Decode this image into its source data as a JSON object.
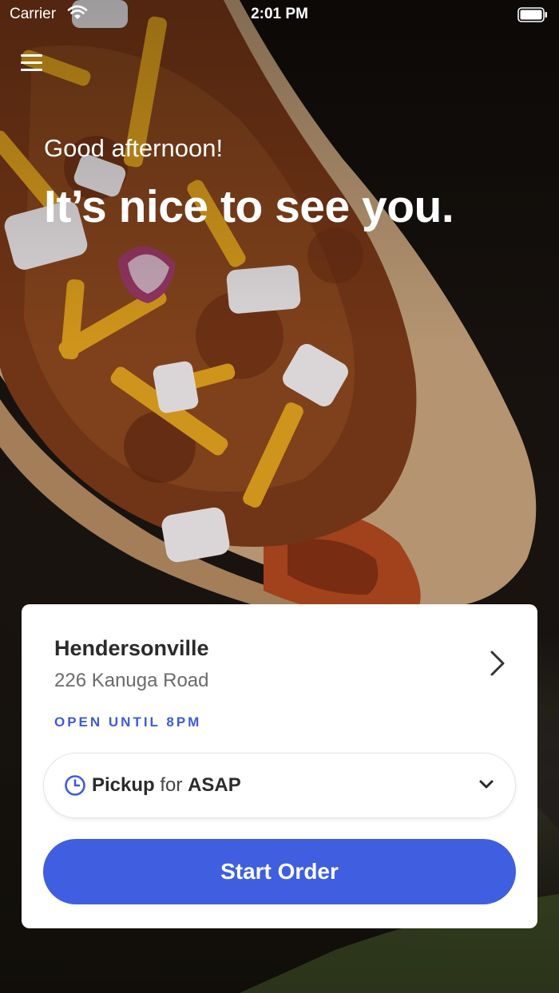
{
  "status_bar": {
    "carrier": "Carrier",
    "time": "2:01 PM"
  },
  "greeting": {
    "subtitle": "Good afternoon!",
    "headline": "It’s nice to see you."
  },
  "location": {
    "name": "Hendersonville",
    "address": "226 Kanuga Road",
    "hours": "OPEN UNTIL 8PM"
  },
  "order_mode": {
    "mode": "Pickup",
    "connector": "for",
    "time": "ASAP"
  },
  "actions": {
    "start_order": "Start Order"
  },
  "colors": {
    "accent": "#3f5ee0",
    "hours_text": "#3d5bd9",
    "card_background": "#ffffff"
  },
  "icons": {
    "menu": "hamburger-menu-icon",
    "location_chevron": "chevron-right-icon",
    "clock": "clock-icon",
    "dropdown": "chevron-down-icon"
  }
}
